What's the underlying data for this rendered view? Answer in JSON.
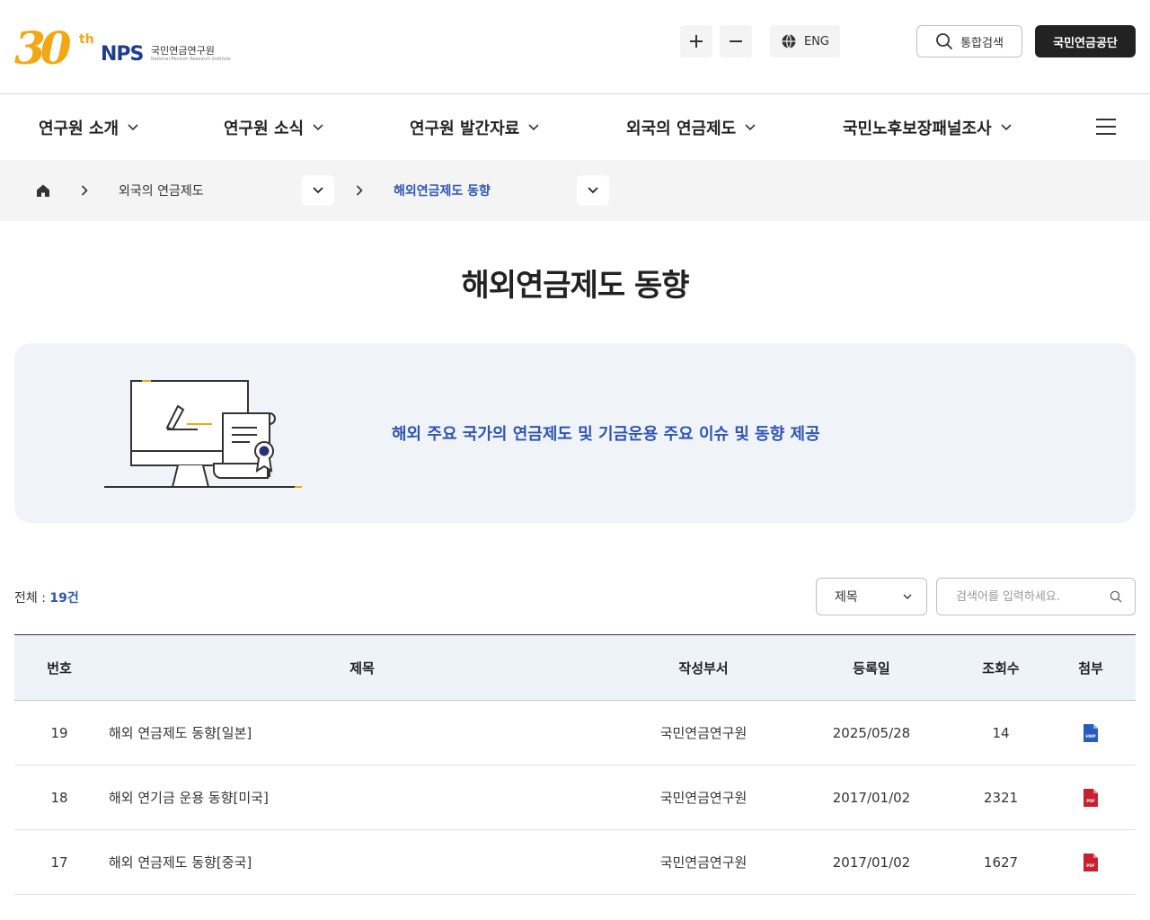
{
  "header": {
    "logo": {
      "anniv": "30",
      "sup": "th",
      "brand": "NPS",
      "org_kr": "국민연금연구원",
      "org_en": "National Pension Research Institute"
    },
    "zoom_in_label": "+",
    "zoom_out_label": "−",
    "lang_label": "ENG",
    "search_label": "통합검색",
    "nps_label": "국민연금공단"
  },
  "gnb": {
    "items": [
      {
        "label": "연구원 소개"
      },
      {
        "label": "연구원 소식"
      },
      {
        "label": "연구원 발간자료"
      },
      {
        "label": "외국의 연금제도"
      },
      {
        "label": "국민노후보장패널조사"
      }
    ]
  },
  "breadcrumb": {
    "level1": "외국의 연금제도",
    "level2": "해외연금제도 동향"
  },
  "page": {
    "title": "해외연금제도 동향",
    "banner_text": "해외 주요 국가의 연금제도 및 기금운용 주요 이슈 및 동향 제공"
  },
  "filter": {
    "total_label": "전체 : ",
    "total_count": "19건",
    "select_value": "제목",
    "search_placeholder": "검색어를 입력하세요."
  },
  "table": {
    "headers": {
      "no": "번호",
      "title": "제목",
      "dept": "작성부서",
      "date": "등록일",
      "views": "조회수",
      "file": "첨부"
    },
    "rows": [
      {
        "no": "19",
        "title": "해외 연금제도 동향[일본]",
        "dept": "국민연금연구원",
        "date": "2025/05/28",
        "views": "14",
        "file": "hwp",
        "file_label": "HWP"
      },
      {
        "no": "18",
        "title": "해외 연기금 운용 동향[미국]",
        "dept": "국민연금연구원",
        "date": "2017/01/02",
        "views": "2321",
        "file": "pdf",
        "file_label": "PDF"
      },
      {
        "no": "17",
        "title": "해외 연금제도 동향[중국]",
        "dept": "국민연금연구원",
        "date": "2017/01/02",
        "views": "1627",
        "file": "pdf",
        "file_label": "PDF"
      }
    ]
  },
  "colors": {
    "accent": "#2f55b4",
    "logo_orange": "#f3a712",
    "pdf_red": "#c8202f",
    "hwp_blue": "#2a5bbf"
  }
}
